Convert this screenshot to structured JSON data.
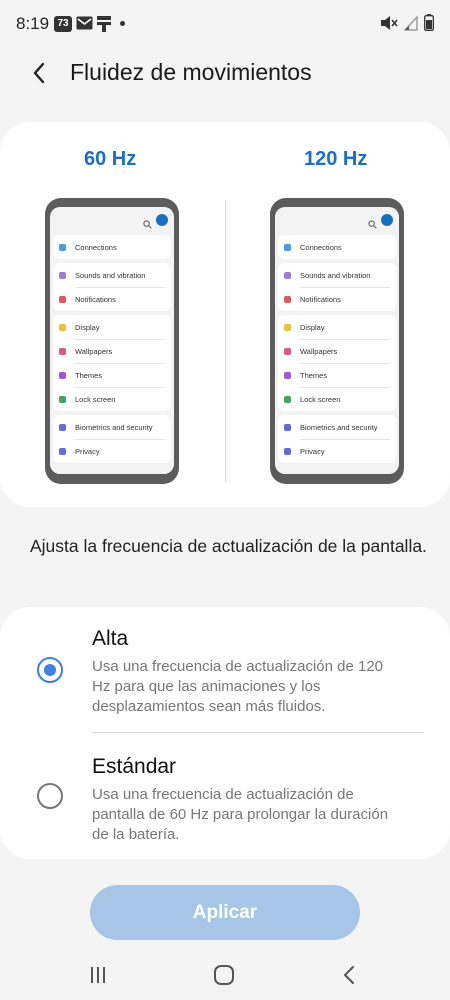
{
  "status_bar": {
    "time": "8:19",
    "badge": "73",
    "icons": [
      "gallery-badge-icon",
      "gmail-icon",
      "vpn-icon",
      "dot-icon",
      "mute-icon",
      "signal-icon",
      "battery-icon"
    ]
  },
  "header": {
    "back_icon": "back-arrow-icon",
    "title": "Fluidez de movimientos"
  },
  "preview": {
    "left_label": "60 Hz",
    "right_label": "120 Hz",
    "phone_items": [
      {
        "label": "Connections",
        "color": "#4a9be0"
      },
      {
        "label": "Sounds and vibration",
        "color": "#9b7ed6"
      },
      {
        "label": "Notifications",
        "color": "#e05a5a"
      },
      {
        "label": "Display",
        "color": "#e8c23a"
      },
      {
        "label": "Wallpapers",
        "color": "#e0568a"
      },
      {
        "label": "Themes",
        "color": "#9b5bd6"
      },
      {
        "label": "Lock screen",
        "color": "#3aa86a"
      },
      {
        "label": "Biometrics and security",
        "color": "#6a6ad6"
      },
      {
        "label": "Privacy",
        "color": "#6a6ad6"
      }
    ]
  },
  "description": "Ajusta la frecuencia de actualización de la pantalla.",
  "options": {
    "high": {
      "title": "Alta",
      "desc": "Usa una frecuencia de actualización de 120 Hz para que las animaciones y los desplazamientos sean más fluidos.",
      "selected": true
    },
    "standard": {
      "title": "Estándar",
      "desc": "Usa una frecuencia de actualización de pantalla de 60 Hz para prolongar la duración de la batería.",
      "selected": false
    }
  },
  "apply_label": "Aplicar",
  "colors": {
    "accent": "#1a6fc4",
    "radio": "#3f7fe0",
    "apply_disabled": "#a7c5e6"
  },
  "navbar": {
    "icons": [
      "recent-apps-icon",
      "home-icon",
      "back-icon"
    ]
  }
}
